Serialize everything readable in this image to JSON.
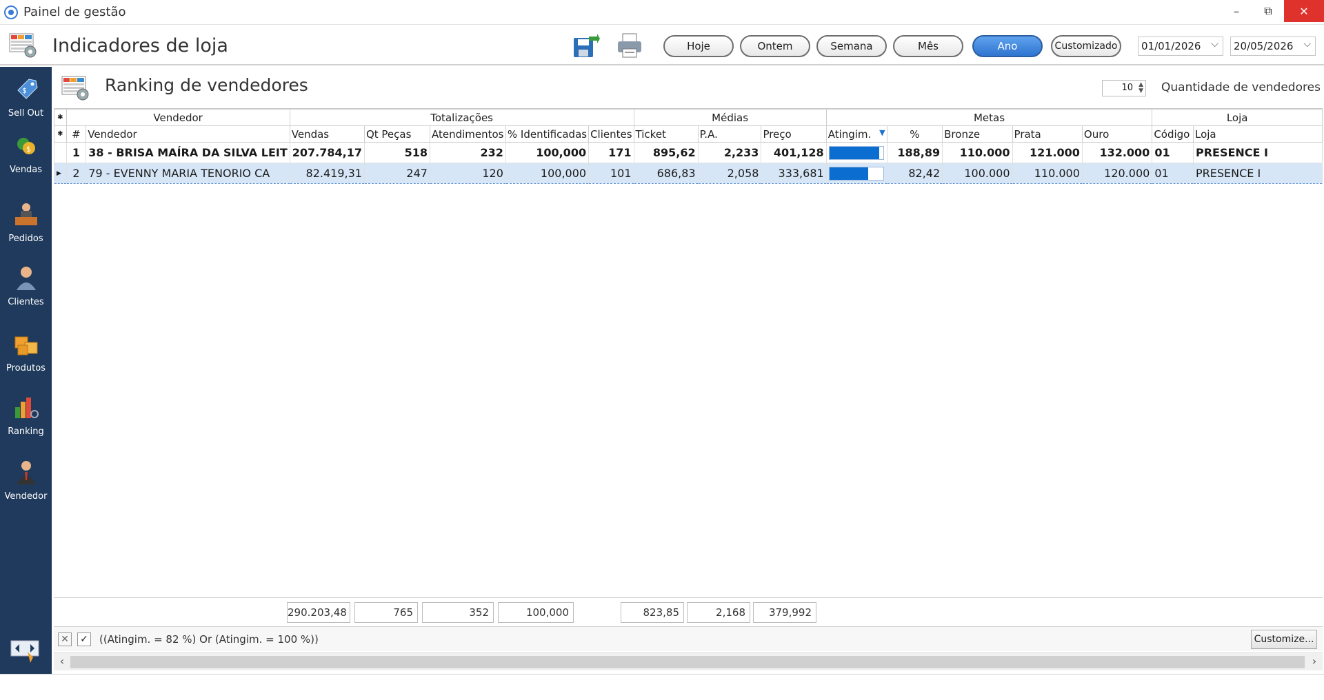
{
  "window": {
    "title": "Painel de gestão",
    "minimize": "–",
    "restore": "⧉",
    "close": "✕"
  },
  "header": {
    "title": "Indicadores de loja",
    "periods": [
      {
        "label": "Hoje",
        "active": false
      },
      {
        "label": "Ontem",
        "active": false
      },
      {
        "label": "Semana",
        "active": false
      },
      {
        "label": "Mês",
        "active": false
      },
      {
        "label": "Ano",
        "active": true
      },
      {
        "label": "Customizado",
        "active": false
      }
    ],
    "date_from": "01/01/2026",
    "date_to": "20/05/2026"
  },
  "sidebar": {
    "items": [
      {
        "label": "Sell Out",
        "icon": "tag-icon"
      },
      {
        "label": "Vendas",
        "icon": "money-icon"
      },
      {
        "label": "Pedidos",
        "icon": "desk-person-icon"
      },
      {
        "label": "Clientes",
        "icon": "customer-icon"
      },
      {
        "label": "Produtos",
        "icon": "boxes-icon"
      },
      {
        "label": "Ranking",
        "icon": "bar-chart-icon"
      },
      {
        "label": "Vendedor",
        "icon": "salesman-icon"
      }
    ]
  },
  "panel": {
    "title": "Ranking de vendedores",
    "quantity_value": "10",
    "quantity_label": "Quantidade de vendedores"
  },
  "grid": {
    "groups": [
      "Vendedor",
      "Totalizações",
      "Médias",
      "Metas",
      "Loja"
    ],
    "columns": [
      "#",
      "Vendedor",
      "Vendas",
      "Qt Peças",
      "Atendimentos",
      "% Identificadas",
      "Clientes",
      "Ticket",
      "P.A.",
      "Preço",
      "Atingim.",
      "%",
      "Bronze",
      "Prata",
      "Ouro",
      "Código",
      "Loja"
    ],
    "rows": [
      {
        "rank": "1",
        "vendedor": "38 - BRISA MAÍRA DA SILVA LEIT",
        "vendas": "207.784,17",
        "pecas": "518",
        "atendimentos": "232",
        "identificadas": "100,000",
        "clientes": "171",
        "ticket": "895,62",
        "pa": "2,233",
        "preco": "401,128",
        "atingim": 0.93,
        "pct": "188,89",
        "bronze": "110.000",
        "prata": "121.000",
        "ouro": "132.000",
        "codigo": "01",
        "loja": "PRESENCE I"
      },
      {
        "rank": "2",
        "vendedor": "79 - EVENNY MARIA TENORIO CA",
        "vendas": "82.419,31",
        "pecas": "247",
        "atendimentos": "120",
        "identificadas": "100,000",
        "clientes": "101",
        "ticket": "686,83",
        "pa": "2,058",
        "preco": "333,681",
        "atingim": 0.72,
        "pct": "82,42",
        "bronze": "100.000",
        "prata": "110.000",
        "ouro": "120.000",
        "codigo": "01",
        "loja": "PRESENCE I"
      }
    ]
  },
  "totals": {
    "vendas": "290.203,48",
    "pecas": "765",
    "atendimentos": "352",
    "identificadas": "100,000",
    "ticket": "823,85",
    "pa": "2,168",
    "preco": "379,992"
  },
  "filter": {
    "expression": "((Atingim. = 82 %) Or (Atingim. = 100 %))",
    "customize_label": "Customize..."
  }
}
